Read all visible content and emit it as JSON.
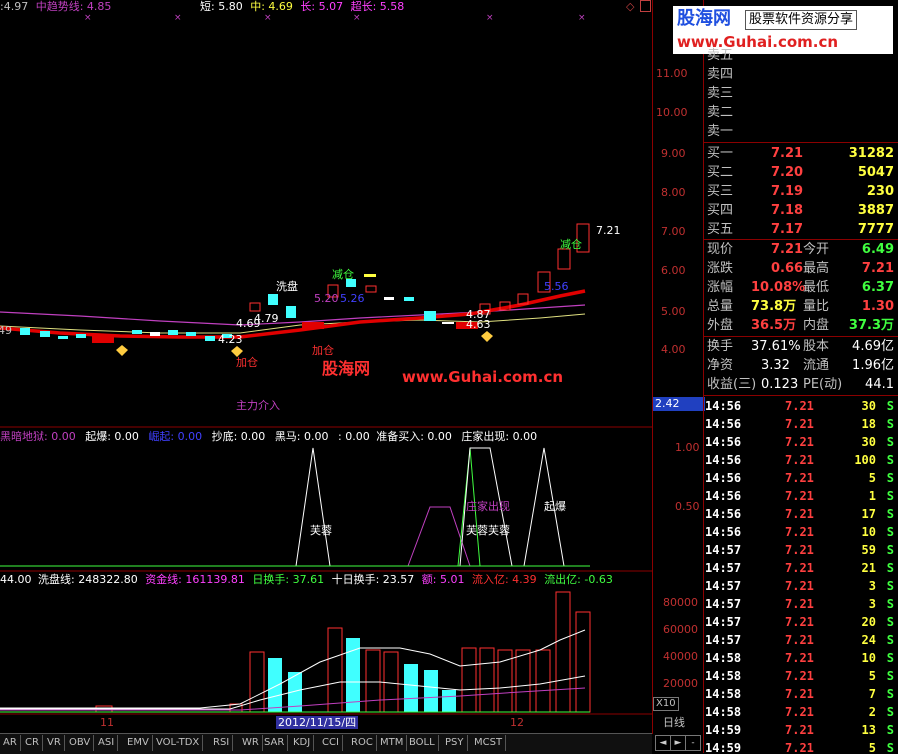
{
  "watermark": {
    "logo_cn": "股海网",
    "logo_text": "股票软件资源分享",
    "logo_url": "www.Guhai.com.cn",
    "chart_cn": "股海网",
    "chart_url": "www.Guhai.com.cn"
  },
  "main_header": {
    "prefix": ":4.97",
    "mid_label": "中趋势线: 4.85",
    "short": "短: 5.80",
    "mid": "中: 4.69",
    "long": "长: 5.07",
    "ultra": "超长: 5.58"
  },
  "y_axis": {
    "main": [
      "11.00",
      "10.00",
      "9.00",
      "8.00",
      "7.00",
      "6.00",
      "5.00",
      "4.00"
    ],
    "cursor_value": "2.42",
    "ind1": [
      "1.00",
      "0.50"
    ],
    "ind2": [
      "80000",
      "60000",
      "40000",
      "20000"
    ],
    "x10": "X10"
  },
  "main_annotations": {
    "wash": "洗盘",
    "reduce": "减仓",
    "add1": "加仓",
    "add2": "加仓",
    "main_enter": "主力介入",
    "p479": "4.79",
    "p469": "4.69",
    "p423": "4.23",
    "p520": "5.20",
    "p526": "5.26",
    "p556": "5.56",
    "p487": "4.87",
    "p463": "4.63",
    "p721": "7.21",
    "p49": "49"
  },
  "ind1_header": {
    "heian": "黑暗地狱: 0.00",
    "qibao": "起爆: 0.00",
    "fuqi": "崛起: 0.00",
    "chaodi": "抄底: 0.00",
    "heima": "黑马: 0.00",
    "colon": ": 0.00",
    "zhunbei": "准备买入: 0.00",
    "zhuangjia": "庄家出现: 0.00"
  },
  "ind1_annotations": {
    "furong1": "芙蓉",
    "zhuangjia": "庄家出现",
    "furong2": "芙蓉芙蓉",
    "qibao": "起爆"
  },
  "ind2_header": {
    "prefix": "44.00",
    "xipan": "洗盘线: 248322.80",
    "zijin": "资金线: 161139.81",
    "rihuan": "日换手: 37.61",
    "shiri": "十日换手: 23.57",
    "e": "额: 5.01",
    "liuru": "流入亿: 4.39",
    "liuchu": "流出亿: -0.63"
  },
  "x_axis": {
    "m11": "11",
    "date": "2012/11/15/四",
    "m12": "12",
    "period": "日线"
  },
  "tabs": [
    "AR",
    "CR",
    "VR",
    "OBV",
    "ASI",
    "EMV",
    "VOL-TDX",
    "RSI",
    "WR",
    "SAR",
    "KDJ",
    "CCI",
    "ROC",
    "MTM",
    "BOLL",
    "PSY",
    "MCST"
  ],
  "nav_buttons": [
    "◄",
    "►",
    "-",
    "+"
  ],
  "sell_orders": [
    {
      "label": "卖五"
    },
    {
      "label": "卖四"
    },
    {
      "label": "卖三"
    },
    {
      "label": "卖二"
    },
    {
      "label": "卖一"
    }
  ],
  "buy_orders": [
    {
      "label": "买一",
      "price": "7.21",
      "vol": "31282"
    },
    {
      "label": "买二",
      "price": "7.20",
      "vol": "5047"
    },
    {
      "label": "买三",
      "price": "7.19",
      "vol": "230"
    },
    {
      "label": "买四",
      "price": "7.18",
      "vol": "3887"
    },
    {
      "label": "买五",
      "price": "7.17",
      "vol": "7777"
    }
  ],
  "stats": [
    {
      "l1": "现价",
      "v1": "7.21",
      "l2": "今开",
      "v2": "6.49",
      "c1": "#ff4040",
      "c2": "#40ff40"
    },
    {
      "l1": "涨跌",
      "v1": "0.66",
      "l2": "最高",
      "v2": "7.21",
      "c1": "#ff4040",
      "c2": "#ff4040"
    },
    {
      "l1": "涨幅",
      "v1": "10.08%",
      "l2": "最低",
      "v2": "6.37",
      "c1": "#ff4040",
      "c2": "#40ff40"
    },
    {
      "l1": "总量",
      "v1": "73.8万",
      "l2": "量比",
      "v2": "1.30",
      "c1": "#ffff40",
      "c2": "#ff4040"
    },
    {
      "l1": "外盘",
      "v1": "36.5万",
      "l2": "内盘",
      "v2": "37.3万",
      "c1": "#ff4040",
      "c2": "#40ff40"
    }
  ],
  "stats2": [
    {
      "l1": "换手",
      "v1": "37.61%",
      "l2": "股本",
      "v2": "4.69亿"
    },
    {
      "l1": "净资",
      "v1": "3.32",
      "l2": "流通",
      "v2": "1.96亿"
    },
    {
      "l1": "收益(三)",
      "v1": "0.123",
      "l2": "PE(动)",
      "v2": "44.1"
    }
  ],
  "ticks": [
    {
      "t": "14:56",
      "p": "7.21",
      "v": "30",
      "s": "S"
    },
    {
      "t": "14:56",
      "p": "7.21",
      "v": "18",
      "s": "S"
    },
    {
      "t": "14:56",
      "p": "7.21",
      "v": "30",
      "s": "S"
    },
    {
      "t": "14:56",
      "p": "7.21",
      "v": "100",
      "s": "S"
    },
    {
      "t": "14:56",
      "p": "7.21",
      "v": "5",
      "s": "S"
    },
    {
      "t": "14:56",
      "p": "7.21",
      "v": "1",
      "s": "S"
    },
    {
      "t": "14:56",
      "p": "7.21",
      "v": "17",
      "s": "S"
    },
    {
      "t": "14:56",
      "p": "7.21",
      "v": "10",
      "s": "S"
    },
    {
      "t": "14:57",
      "p": "7.21",
      "v": "59",
      "s": "S"
    },
    {
      "t": "14:57",
      "p": "7.21",
      "v": "21",
      "s": "S"
    },
    {
      "t": "14:57",
      "p": "7.21",
      "v": "3",
      "s": "S"
    },
    {
      "t": "14:57",
      "p": "7.21",
      "v": "3",
      "s": "S"
    },
    {
      "t": "14:57",
      "p": "7.21",
      "v": "20",
      "s": "S"
    },
    {
      "t": "14:57",
      "p": "7.21",
      "v": "24",
      "s": "S"
    },
    {
      "t": "14:58",
      "p": "7.21",
      "v": "10",
      "s": "S"
    },
    {
      "t": "14:58",
      "p": "7.21",
      "v": "5",
      "s": "S"
    },
    {
      "t": "14:58",
      "p": "7.21",
      "v": "7",
      "s": "S"
    },
    {
      "t": "14:58",
      "p": "7.21",
      "v": "2",
      "s": "S"
    },
    {
      "t": "14:59",
      "p": "7.21",
      "v": "13",
      "s": "S"
    },
    {
      "t": "14:59",
      "p": "7.21",
      "v": "5",
      "s": "S"
    }
  ],
  "colors": {
    "up": "#ff3030",
    "down": "#40ffff",
    "ma_red": "#e00000",
    "purple": "#c040c0",
    "grid": "#8b0000",
    "axis_text": "#c03030",
    "green": "#40ff40",
    "yellow": "#ffff40"
  }
}
